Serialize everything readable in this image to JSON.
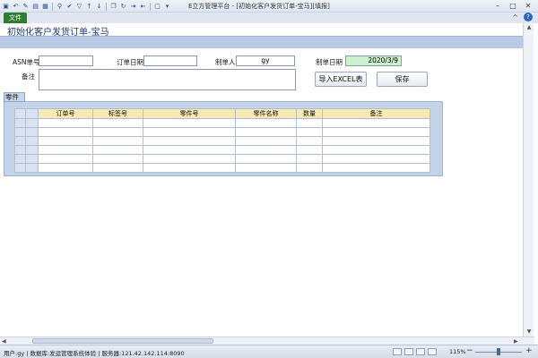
{
  "window": {
    "title": "E立方管理平台 - [初始化客户发货订单-宝马][填报]",
    "controls": [
      "–",
      "□",
      "✕"
    ]
  },
  "quick_access_icons": [
    "save-icon",
    "undo-icon",
    "edit-icon",
    "print-icon",
    "table-icon",
    "zoom-icon",
    "check-icon",
    "filter-icon",
    "sort-asc-icon",
    "sort-desc-icon",
    "copy-icon",
    "refresh-icon",
    "export-icon",
    "import-icon",
    "window-icon",
    "menu-icon"
  ],
  "ribbon": {
    "file_tab": "文件",
    "minimize_icon": "^",
    "help_icon": "?"
  },
  "form": {
    "title": "初始化客户发货订单-宝马",
    "fields": {
      "asn_label": "ASN单号",
      "asn_value": "",
      "order_date_label": "订单日期",
      "order_date_value": "",
      "maker_label": "制单人",
      "maker_value": "gy",
      "make_date_label": "制单日期",
      "make_date_value": "2020/3/9",
      "remark_label": "备注",
      "remark_value": ""
    },
    "buttons": {
      "import_excel": "导入EXCEL表",
      "save": "保存"
    }
  },
  "subform": {
    "caption": "零件",
    "columns": [
      "订单号",
      "标签号",
      "零件号",
      "零件名称",
      "数量",
      "备注"
    ],
    "rows": [
      [
        "",
        "",
        "",
        "",
        "",
        ""
      ],
      [
        "",
        "",
        "",
        "",
        "",
        ""
      ],
      [
        "",
        "",
        "",
        "",
        "",
        ""
      ],
      [
        "",
        "",
        "",
        "",
        "",
        ""
      ],
      [
        "",
        "",
        "",
        "",
        "",
        ""
      ],
      [
        "",
        "",
        "",
        "",
        "",
        ""
      ]
    ]
  },
  "status_bar": {
    "text": "用户:gy | 数据库:发运管理系统体验 | 服务器:121.42.142.114:8090",
    "zoom": "115%"
  }
}
